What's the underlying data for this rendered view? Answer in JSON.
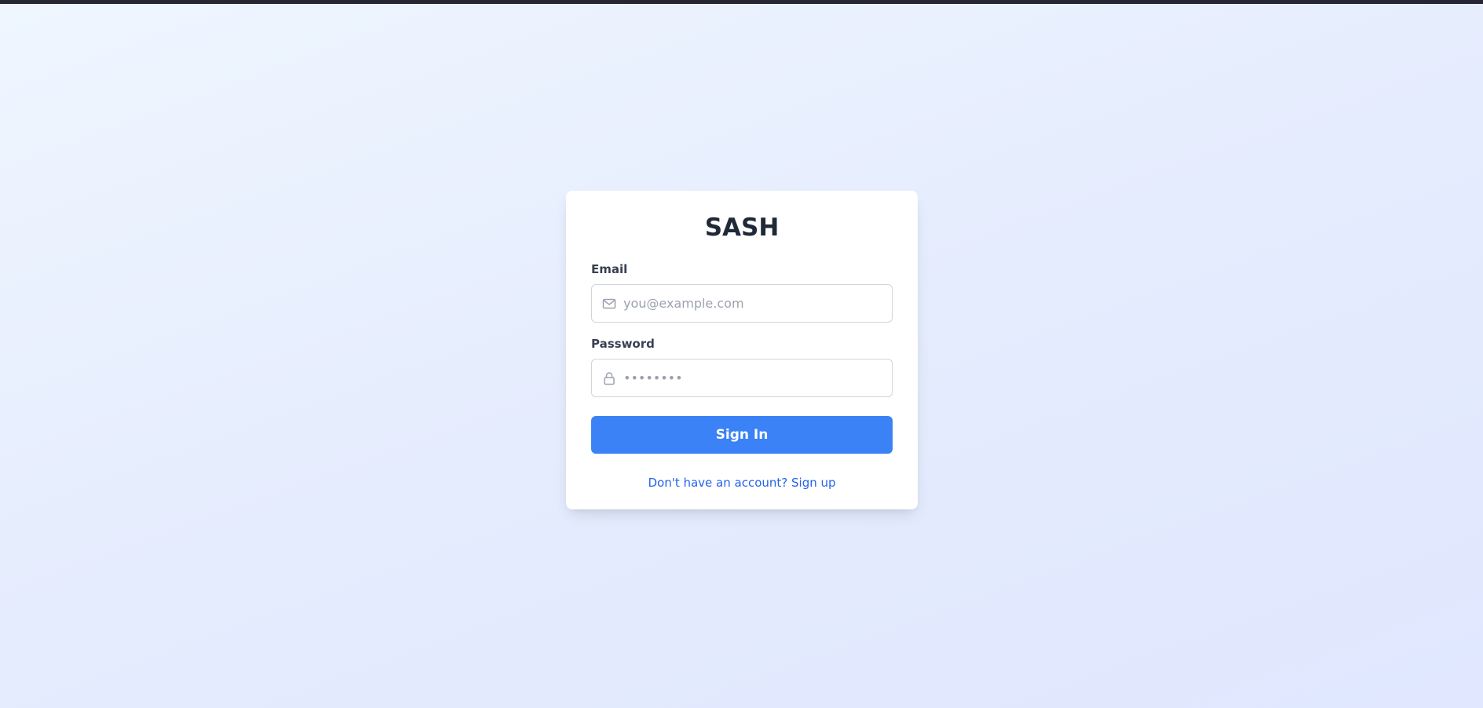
{
  "app": {
    "title": "SASH"
  },
  "form": {
    "email_label": "Email",
    "email_placeholder": "you@example.com",
    "email_value": "",
    "password_label": "Password",
    "password_placeholder": "••••••••",
    "password_value": "",
    "submit_label": "Sign In",
    "signup_text": "Don't have an account? Sign up"
  },
  "icons": {
    "email": "mail-icon",
    "password": "lock-icon"
  },
  "colors": {
    "accent": "#3b82f6",
    "link": "#2563eb",
    "title": "#1f2937",
    "top_bar": "#272733"
  }
}
